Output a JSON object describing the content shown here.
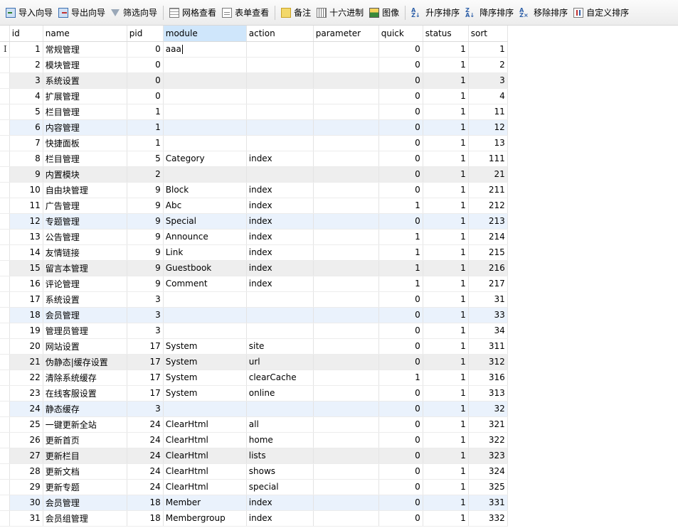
{
  "toolbar": {
    "import": "导入向导",
    "export": "导出向导",
    "filter": "筛选向导",
    "grid_view": "网格查看",
    "form_view": "表单查看",
    "note": "备注",
    "hex": "十六进制",
    "image": "图像",
    "sort_asc": "升序排序",
    "sort_desc": "降序排序",
    "remove_sort": "移除排序",
    "custom_sort": "自定义排序"
  },
  "table": {
    "columns": [
      "id",
      "name",
      "pid",
      "module",
      "action",
      "parameter",
      "quick",
      "status",
      "sort"
    ],
    "rows": [
      [
        "1",
        "常规管理",
        "0",
        "aaa",
        "",
        "",
        "0",
        "1",
        "1"
      ],
      [
        "2",
        "模块管理",
        "0",
        "",
        "",
        "",
        "0",
        "1",
        "2"
      ],
      [
        "3",
        "系统设置",
        "0",
        "",
        "",
        "",
        "0",
        "1",
        "3"
      ],
      [
        "4",
        "扩展管理",
        "0",
        "",
        "",
        "",
        "0",
        "1",
        "4"
      ],
      [
        "5",
        "栏目管理",
        "1",
        "",
        "",
        "",
        "0",
        "1",
        "11"
      ],
      [
        "6",
        "内容管理",
        "1",
        "",
        "",
        "",
        "0",
        "1",
        "12"
      ],
      [
        "7",
        "快捷面板",
        "1",
        "",
        "",
        "",
        "0",
        "1",
        "13"
      ],
      [
        "8",
        "栏目管理",
        "5",
        "Category",
        "index",
        "",
        "0",
        "1",
        "111"
      ],
      [
        "9",
        "内置模块",
        "2",
        "",
        "",
        "",
        "0",
        "1",
        "21"
      ],
      [
        "10",
        "自由块管理",
        "9",
        "Block",
        "index",
        "",
        "0",
        "1",
        "211"
      ],
      [
        "11",
        "广告管理",
        "9",
        "Abc",
        "index",
        "",
        "1",
        "1",
        "212"
      ],
      [
        "12",
        "专题管理",
        "9",
        "Special",
        "index",
        "",
        "0",
        "1",
        "213"
      ],
      [
        "13",
        "公告管理",
        "9",
        "Announce",
        "index",
        "",
        "1",
        "1",
        "214"
      ],
      [
        "14",
        "友情链接",
        "9",
        "Link",
        "index",
        "",
        "1",
        "1",
        "215"
      ],
      [
        "15",
        "留言本管理",
        "9",
        "Guestbook",
        "index",
        "",
        "1",
        "1",
        "216"
      ],
      [
        "16",
        "评论管理",
        "9",
        "Comment",
        "index",
        "",
        "1",
        "1",
        "217"
      ],
      [
        "17",
        "系统设置",
        "3",
        "",
        "",
        "",
        "0",
        "1",
        "31"
      ],
      [
        "18",
        "会员管理",
        "3",
        "",
        "",
        "",
        "0",
        "1",
        "33"
      ],
      [
        "19",
        "管理员管理",
        "3",
        "",
        "",
        "",
        "0",
        "1",
        "34"
      ],
      [
        "20",
        "网站设置",
        "17",
        "System",
        "site",
        "",
        "0",
        "1",
        "311"
      ],
      [
        "21",
        "伪静态|缓存设置",
        "17",
        "System",
        "url",
        "",
        "0",
        "1",
        "312"
      ],
      [
        "22",
        "清除系统缓存",
        "17",
        "System",
        "clearCache",
        "",
        "1",
        "1",
        "316"
      ],
      [
        "23",
        "在线客服设置",
        "17",
        "System",
        "online",
        "",
        "0",
        "1",
        "313"
      ],
      [
        "24",
        "静态缓存",
        "3",
        "",
        "",
        "",
        "0",
        "1",
        "32"
      ],
      [
        "25",
        "一键更新全站",
        "24",
        "ClearHtml",
        "all",
        "",
        "0",
        "1",
        "321"
      ],
      [
        "26",
        "更新首页",
        "24",
        "ClearHtml",
        "home",
        "",
        "0",
        "1",
        "322"
      ],
      [
        "27",
        "更新栏目",
        "24",
        "ClearHtml",
        "lists",
        "",
        "0",
        "1",
        "323"
      ],
      [
        "28",
        "更新文档",
        "24",
        "ClearHtml",
        "shows",
        "",
        "0",
        "1",
        "324"
      ],
      [
        "29",
        "更新专题",
        "24",
        "ClearHtml",
        "special",
        "",
        "0",
        "1",
        "325"
      ],
      [
        "30",
        "会员管理",
        "18",
        "Member",
        "index",
        "",
        "0",
        "1",
        "331"
      ],
      [
        "31",
        "会员组管理",
        "18",
        "Membergroup",
        "index",
        "",
        "0",
        "1",
        "332"
      ]
    ],
    "selected_column": "module",
    "current_row_marker": "I"
  }
}
